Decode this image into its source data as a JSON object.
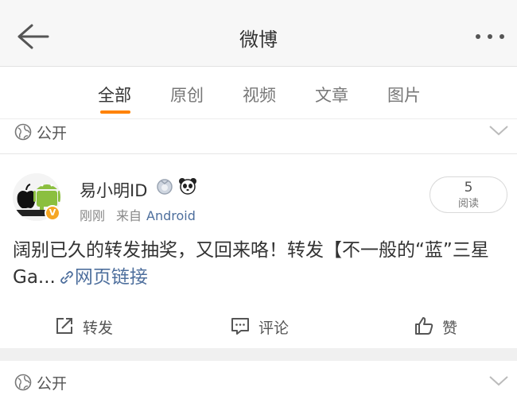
{
  "nav": {
    "title": "微博",
    "back_icon": "back-arrow-icon",
    "more_icon": "more-dots-icon"
  },
  "tabs": [
    {
      "label": "全部",
      "active": true
    },
    {
      "label": "原创",
      "active": false
    },
    {
      "label": "视频",
      "active": false
    },
    {
      "label": "文章",
      "active": false
    },
    {
      "label": "图片",
      "active": false
    }
  ],
  "visibility": {
    "label": "公开",
    "icon": "globe-icon"
  },
  "post": {
    "username": "易小明ID",
    "time": "刚刚",
    "from_prefix": "来自",
    "source": "Android",
    "reads": {
      "count": "5",
      "label": "阅读"
    },
    "text": "阔别已久的转发抽奖，又回来咯！转发【不一般的“蓝”三星Ga...",
    "link_text": "网页链接"
  },
  "actions": {
    "repost": "转发",
    "comment": "评论",
    "like": "赞"
  },
  "next_visibility": {
    "label": "公开"
  },
  "colors": {
    "accent": "#ff8200",
    "link": "#4e6f9d",
    "verified": "#f5a623"
  }
}
